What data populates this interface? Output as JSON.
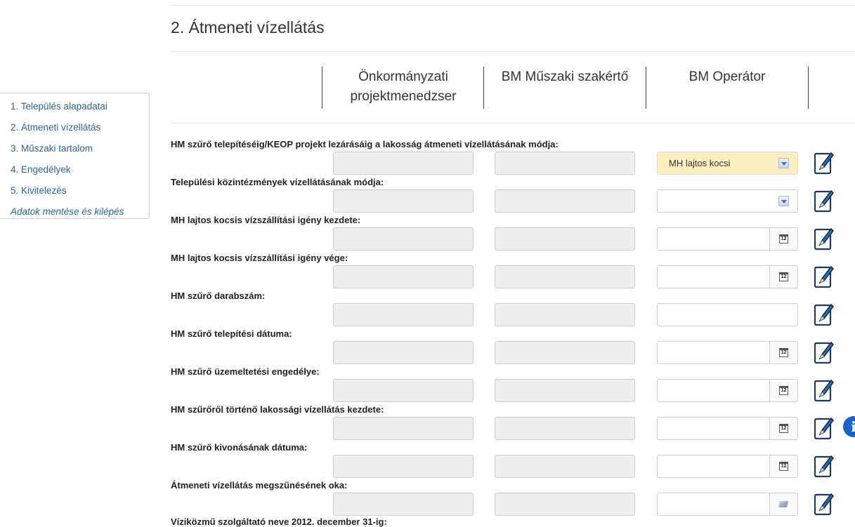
{
  "page": {
    "title": "2. Átmeneti vízellátás"
  },
  "columns": [
    {
      "label_line1": "Önkormányzati",
      "label_line2": "projektmenedzser"
    },
    {
      "label_line1": "BM Műszaki szakértő",
      "label_line2": ""
    },
    {
      "label_line1": "BM Operátor",
      "label_line2": ""
    }
  ],
  "sidebar": {
    "items": [
      {
        "label": "1. Település alapadatai"
      },
      {
        "label": "2. Átmeneti vízellátás"
      },
      {
        "label": "3. Műszaki tartalom"
      },
      {
        "label": "4. Engedélyek"
      },
      {
        "label": "5. Kivitelezés"
      },
      {
        "label": "Adatok mentése és kilépés"
      }
    ]
  },
  "rows": [
    {
      "label": "HM szűrő telepítéséig/KEOP projekt lezárásáig a lakosság átmeneti vízellátásának módja:",
      "type": "select",
      "value": "MH lajtos kocsi"
    },
    {
      "label": "Települési közintézmények vízellátásának módja:",
      "type": "select",
      "value": ""
    },
    {
      "label": "MH lajtos kocsis vízszállítási igény kezdete:",
      "type": "date",
      "value": ""
    },
    {
      "label": "MH lajtos kocsis vízszállítási igény vége:",
      "type": "date",
      "value": ""
    },
    {
      "label": "HM szűrő darabszám:",
      "type": "text",
      "value": ""
    },
    {
      "label": "HM szűrő telepítési dátuma:",
      "type": "date",
      "value": ""
    },
    {
      "label": "HM szűrő üzemeltetési engedélye:",
      "type": "date",
      "value": ""
    },
    {
      "label": "HM szűrőről történő lakossági vízellátás kezdete:",
      "type": "date",
      "value": ""
    },
    {
      "label": "HM szűrő kivonásának dátuma:",
      "type": "date",
      "value": ""
    },
    {
      "label": "Átmeneti vízellátás megszűnésének oka:",
      "type": "text-clear",
      "value": ""
    }
  ],
  "cut_off_label": "Víziközmű szolgáltató neve 2012. december 31-ig:",
  "icons": {
    "calendar": "calendar-icon",
    "calendar_text": "12",
    "edit": "edit-pencil-icon",
    "info": "info-icon",
    "info_text": "i",
    "dropdown": "chevron-down-icon",
    "clear": "eraser-icon"
  },
  "colors": {
    "link": "#2a6496",
    "selected_bg": "#fcefbf",
    "readonly_bg": "#eeeeee",
    "info": "#1a62c4"
  }
}
